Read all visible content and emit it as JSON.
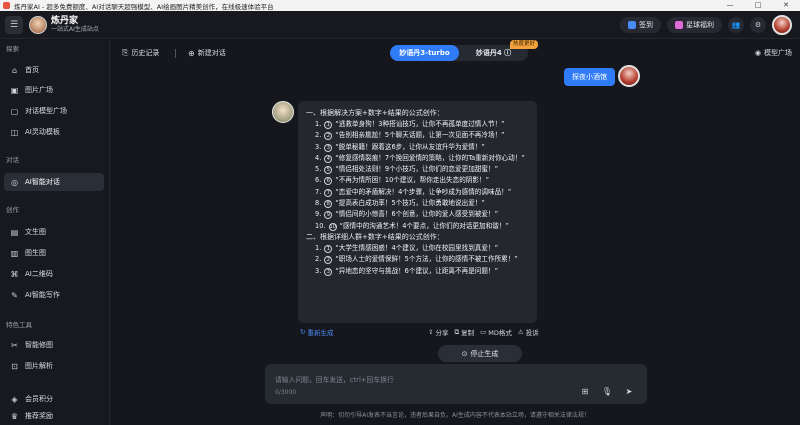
{
  "window": {
    "title": "炼丹家AI - 超多免费额度、AI对话聊天超强模型、AI绘画图片精美创作，在线极速体验平台",
    "controls": [
      "—",
      "□",
      "✕"
    ]
  },
  "header": {
    "brand_name": "炼丹家",
    "brand_tagline": "一站式AI生成站点",
    "checkin_label": "签到",
    "benefit_label": "星球福利"
  },
  "sidebar": {
    "sections": [
      {
        "title": "探索",
        "items": [
          {
            "label": "首页",
            "icon": "home-icon"
          },
          {
            "label": "图片广场",
            "icon": "image-icon"
          },
          {
            "label": "对话模型广场",
            "icon": "chat-square-icon"
          },
          {
            "label": "AI灵动模板",
            "icon": "template-icon"
          }
        ]
      },
      {
        "title": "对话",
        "items": [
          {
            "label": "AI智能对话",
            "icon": "chat-icon",
            "active": true
          }
        ]
      },
      {
        "title": "创作",
        "items": [
          {
            "label": "文生图",
            "icon": "text-to-image-icon"
          },
          {
            "label": "图生图",
            "icon": "image-to-image-icon"
          },
          {
            "label": "AI二维码",
            "icon": "qrcode-icon"
          },
          {
            "label": "AI智能写作",
            "icon": "write-icon"
          }
        ]
      },
      {
        "title": "特色工具",
        "items": [
          {
            "label": "智能修图",
            "icon": "retouch-icon"
          },
          {
            "label": "图片解析",
            "icon": "analyze-icon"
          }
        ]
      },
      {
        "title": "",
        "items": [
          {
            "label": "会员积分",
            "icon": "points-icon"
          },
          {
            "label": "推荐奖励",
            "icon": "reward-icon"
          }
        ]
      }
    ]
  },
  "topbar": {
    "history_label": "历史记录",
    "new_chat_label": "新建对话",
    "models": [
      "妙语丹3-turbo",
      "妙语丹4 ⓘ"
    ],
    "active_model": "妙语丹3-turbo",
    "hot_badge": "热度更好",
    "model_square_label": "模型广场"
  },
  "chat": {
    "user_message": "探夜小酒馆",
    "answer": {
      "heading1": "一、根据解决方案+数字+结果的公式创作：",
      "group1": [
        {
          "n": "1",
          "text": "“逃救单身狗！3种搭讪技巧，让你不再孤单度过情人节！”"
        },
        {
          "n": "2",
          "text": "“告别相亲尴尬！5个聊天话题，让第一次见面不再冷场！”"
        },
        {
          "n": "3",
          "text": "“脱单秘籍！跟着这6步，让你从友谊升华为爱情！”"
        },
        {
          "n": "4",
          "text": "“修复感情裂痕！7个挽回爱情的策略，让你的Ta重新对你心动！”"
        },
        {
          "n": "5",
          "text": "“情侣相处法则！9个小技巧，让你们的恋爱更加甜蜜！”"
        },
        {
          "n": "6",
          "text": "“不再为情所困！10个建议，帮你走出失恋的阴影！”"
        },
        {
          "n": "7",
          "text": "“恋爱中的矛盾解决！4个步骤，让争吵成为感情的调味品！”"
        },
        {
          "n": "8",
          "text": "“提高表白成功率！5个技巧，让你勇敢地说出爱！”"
        },
        {
          "n": "9",
          "text": "“情侣间的小惊喜！6个创意，让你的爱人感受到被爱！”"
        },
        {
          "n": "10",
          "text": "“感情中的沟通艺术！4个要点，让你们的对话更加和谐！”"
        }
      ],
      "heading2": "二、根据详细人群+数字+结果的公式创作：",
      "group2": [
        {
          "n": "1",
          "text": "“大学生情感困惑！4个建议，让你在校园里找到真爱！”"
        },
        {
          "n": "2",
          "text": "“职场人士的爱情保鲜！5个方法，让你的感情不被工作所累！”"
        },
        {
          "n": "3",
          "text": "“异地恋的坚守与挑战！6个建议，让距离不再是问题！”"
        }
      ]
    },
    "regenerate_label": "重新生成",
    "actions": [
      "分享",
      "复制",
      "MD格式",
      "投诉"
    ],
    "stop_label": "停止生成"
  },
  "input": {
    "placeholder": "请输入问题，回车发送，ctrl+回车换行",
    "counter": "0/3000"
  },
  "disclaimer": "声明：切勿引导AI发表不当言论，违者后果自负。AI生成内容不代表本站立场，请遵守相关法律法规！",
  "colors": {
    "accent": "#2f7cf6",
    "badge": "#f2a23c",
    "background": "#15171c"
  }
}
